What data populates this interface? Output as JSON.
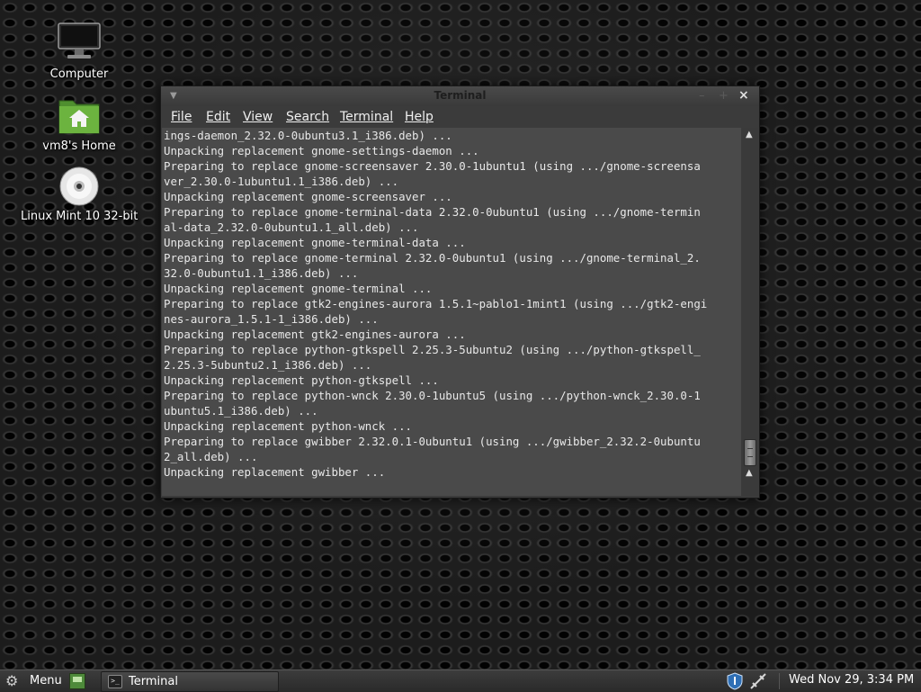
{
  "desktop": {
    "icons": [
      {
        "label": "Computer",
        "icon": "computer-icon"
      },
      {
        "label": "vm8's Home",
        "icon": "home-folder-icon"
      },
      {
        "label": "Linux Mint 10 32-bit",
        "icon": "disc-icon"
      }
    ]
  },
  "window": {
    "title": "Terminal",
    "menu": [
      "File",
      "Edit",
      "View",
      "Search",
      "Terminal",
      "Help"
    ],
    "lines": [
      "ings-daemon_2.32.0-0ubuntu3.1_i386.deb) ...",
      "Unpacking replacement gnome-settings-daemon ...",
      "Preparing to replace gnome-screensaver 2.30.0-1ubuntu1 (using .../gnome-screensa",
      "ver_2.30.0-1ubuntu1.1_i386.deb) ...",
      "Unpacking replacement gnome-screensaver ...",
      "Preparing to replace gnome-terminal-data 2.32.0-0ubuntu1 (using .../gnome-termin",
      "al-data_2.32.0-0ubuntu1.1_all.deb) ...",
      "Unpacking replacement gnome-terminal-data ...",
      "Preparing to replace gnome-terminal 2.32.0-0ubuntu1 (using .../gnome-terminal_2.",
      "32.0-0ubuntu1.1_i386.deb) ...",
      "Unpacking replacement gnome-terminal ...",
      "Preparing to replace gtk2-engines-aurora 1.5.1~pablo1-1mint1 (using .../gtk2-engi",
      "nes-aurora_1.5.1-1_i386.deb) ...",
      "Unpacking replacement gtk2-engines-aurora ...",
      "Preparing to replace python-gtkspell 2.25.3-5ubuntu2 (using .../python-gtkspell_",
      "2.25.3-5ubuntu2.1_i386.deb) ...",
      "Unpacking replacement python-gtkspell ...",
      "Preparing to replace python-wnck 2.30.0-1ubuntu5 (using .../python-wnck_2.30.0-1",
      "ubuntu5.1_i386.deb) ...",
      "Unpacking replacement python-wnck ...",
      "Preparing to replace gwibber 2.32.0.1-0ubuntu1 (using .../gwibber_2.32.2-0ubuntu",
      "2_all.deb) ...",
      "Unpacking replacement gwibber ..."
    ]
  },
  "panel": {
    "menu_label": "Menu",
    "task_label": "Terminal",
    "clock": "Wed Nov 29,  3:34 PM"
  }
}
